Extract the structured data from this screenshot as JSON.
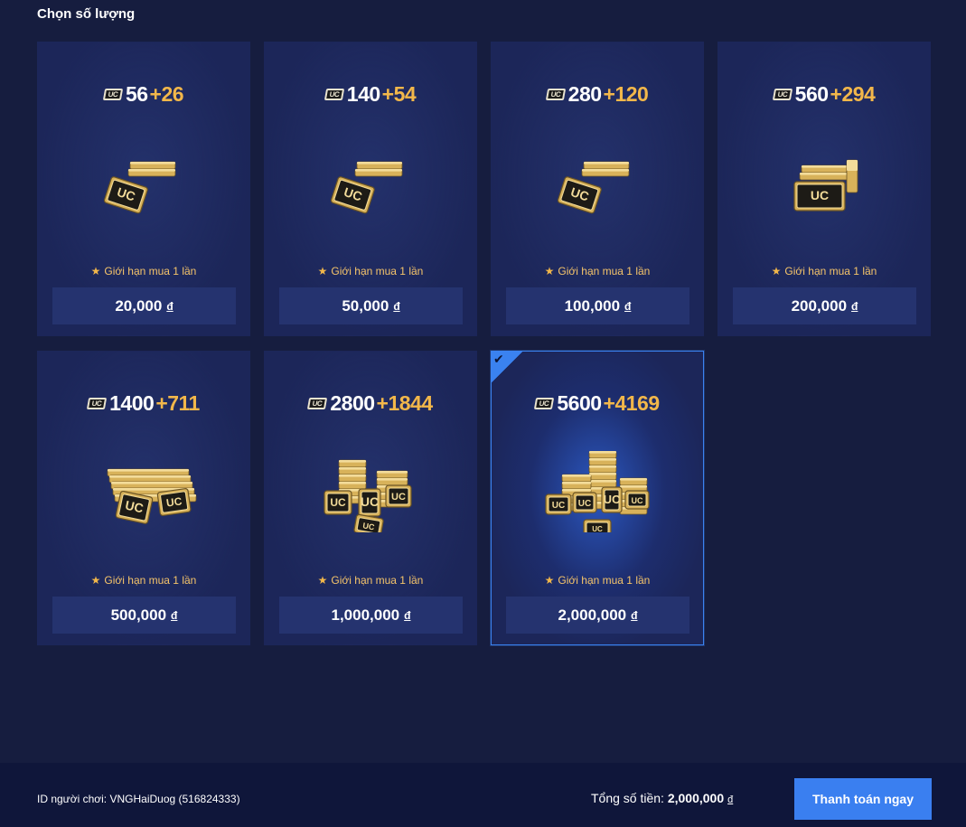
{
  "section_title": "Chọn số lượng",
  "packages": [
    {
      "base": "56",
      "bonus": "+26",
      "limit": "Giới hạn mua 1 lần",
      "price": "20,000",
      "currency": "đ",
      "art": "small",
      "selected": false
    },
    {
      "base": "140",
      "bonus": "+54",
      "limit": "Giới hạn mua 1 lần",
      "price": "50,000",
      "currency": "đ",
      "art": "small",
      "selected": false
    },
    {
      "base": "280",
      "bonus": "+120",
      "limit": "Giới hạn mua 1 lần",
      "price": "100,000",
      "currency": "đ",
      "art": "small",
      "selected": false
    },
    {
      "base": "560",
      "bonus": "+294",
      "limit": "Giới hạn mua 1 lần",
      "price": "200,000",
      "currency": "đ",
      "art": "medium",
      "selected": false
    },
    {
      "base": "1400",
      "bonus": "+711",
      "limit": "Giới hạn mua 1 lần",
      "price": "500,000",
      "currency": "đ",
      "art": "stack",
      "selected": false
    },
    {
      "base": "2800",
      "bonus": "+1844",
      "limit": "Giới hạn mua 1 lần",
      "price": "1,000,000",
      "currency": "đ",
      "art": "pile",
      "selected": false
    },
    {
      "base": "5600",
      "bonus": "+4169",
      "limit": "Giới hạn mua 1 lần",
      "price": "2,000,000",
      "currency": "đ",
      "art": "big-pile",
      "selected": true
    }
  ],
  "uc_icon_text": "UC",
  "footer": {
    "player_label": "ID người chơi:",
    "player_value": "VNGHaiDuog (516824333)",
    "total_label": "Tổng số tiền:",
    "total_value": "2,000,000",
    "total_currency": "đ",
    "pay_label": "Thanh toán ngay"
  },
  "colors": {
    "accent": "#3a7ff0",
    "bonus": "#f2b74a",
    "card": "#1c2659",
    "price_bg": "#25336f"
  },
  "icons": {
    "check": "checkmark-icon",
    "star": "star-icon",
    "uc": "uc-badge-icon"
  }
}
